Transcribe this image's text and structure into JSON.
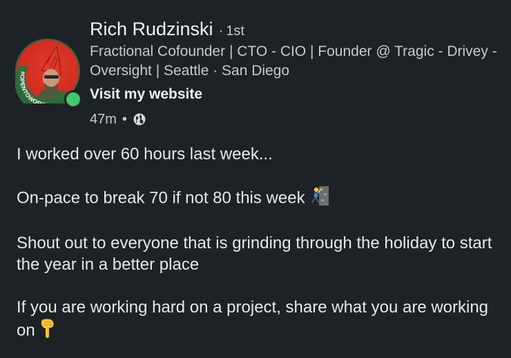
{
  "author": {
    "name": "Rich Rudzinski",
    "degree": "1st",
    "headline": "Fractional Cofounder | CTO - CIO | Founder @ Tragic - Drivey - Oversight | Seattle · San Diego",
    "website_label": "Visit my website",
    "avatar_badge_text": "#OPENTOWORK"
  },
  "meta": {
    "time_ago": "47m",
    "separator": "•",
    "visibility_icon": "globe-icon"
  },
  "post": {
    "paragraphs": [
      "I worked over 60 hours last week...",
      "On-pace to break 70 if not 80 this week",
      "Shout out to everyone that is grinding through the holiday to start the year in a better place",
      "If you are working hard on a project, share what you are working on"
    ],
    "emoji_1": "person-climbing-emoji",
    "emoji_2": "pointing-down-emoji"
  },
  "colors": {
    "background": "#1d2226",
    "primary_text": "#e8e8e8",
    "secondary_text": "#c9c9c9",
    "avatar_red": "#d22d22",
    "online_green": "#44c76a"
  }
}
